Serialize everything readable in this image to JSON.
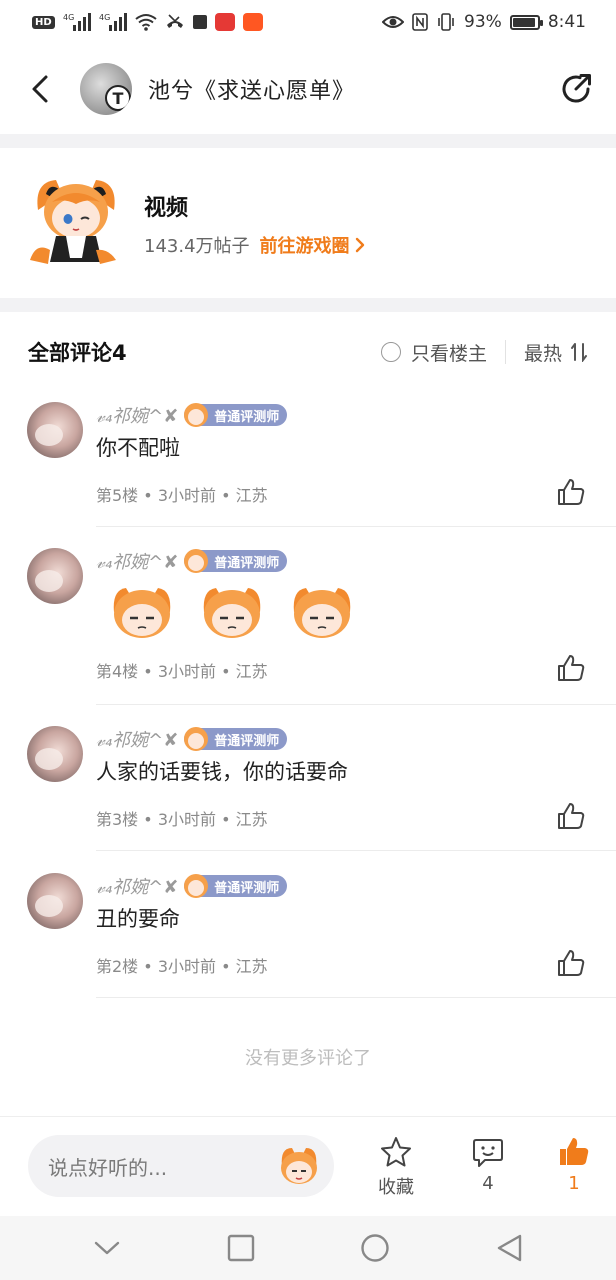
{
  "status_bar": {
    "left_icons": [
      "hd-icon",
      "signal-4g-icon",
      "signal-4g-icon",
      "wifi-icon",
      "missed-call-icon",
      "stop-icon",
      "weibo-app-icon",
      "taobao-app-icon"
    ],
    "hd": "HD",
    "network_a": "4G",
    "network_b": "4G",
    "battery_percent": "93%",
    "battery_level": 0.93,
    "time": "8:41"
  },
  "header": {
    "title": "池兮《求送心愿单》",
    "avatar_letter": "T"
  },
  "forum": {
    "name": "视频",
    "post_count": "143.4万帖子",
    "link_label": "前往游戏圈"
  },
  "comments_header": {
    "title": "全部评论4",
    "only_op_label": "只看楼主",
    "sort_label": "最热"
  },
  "comments": [
    {
      "user": "𝓋₄祁婉^✘",
      "badge": "普通评测师",
      "text": "你不配啦",
      "floor": "第5楼",
      "time": "3小时前",
      "location": "江苏",
      "stickers": 0
    },
    {
      "user": "𝓋₄祁婉^✘",
      "badge": "普通评测师",
      "text": "",
      "floor": "第4楼",
      "time": "3小时前",
      "location": "江苏",
      "stickers": 3
    },
    {
      "user": "𝓋₄祁婉^✘",
      "badge": "普通评测师",
      "text": "人家的话要钱，你的话要命",
      "floor": "第3楼",
      "time": "3小时前",
      "location": "江苏",
      "stickers": 0
    },
    {
      "user": "𝓋₄祁婉^✘",
      "badge": "普通评测师",
      "text": "丑的要命",
      "floor": "第2楼",
      "time": "3小时前",
      "location": "江苏",
      "stickers": 0
    }
  ],
  "info_separator": "•",
  "no_more": "没有更多评论了",
  "bottom_bar": {
    "input_placeholder": "说点好听的...",
    "favorite_label": "收藏",
    "comment_count": "4",
    "like_count": "1"
  },
  "colors": {
    "accent": "#f07c1b",
    "badge": "#8c99c9",
    "divider_band": "#f2f2f4"
  }
}
